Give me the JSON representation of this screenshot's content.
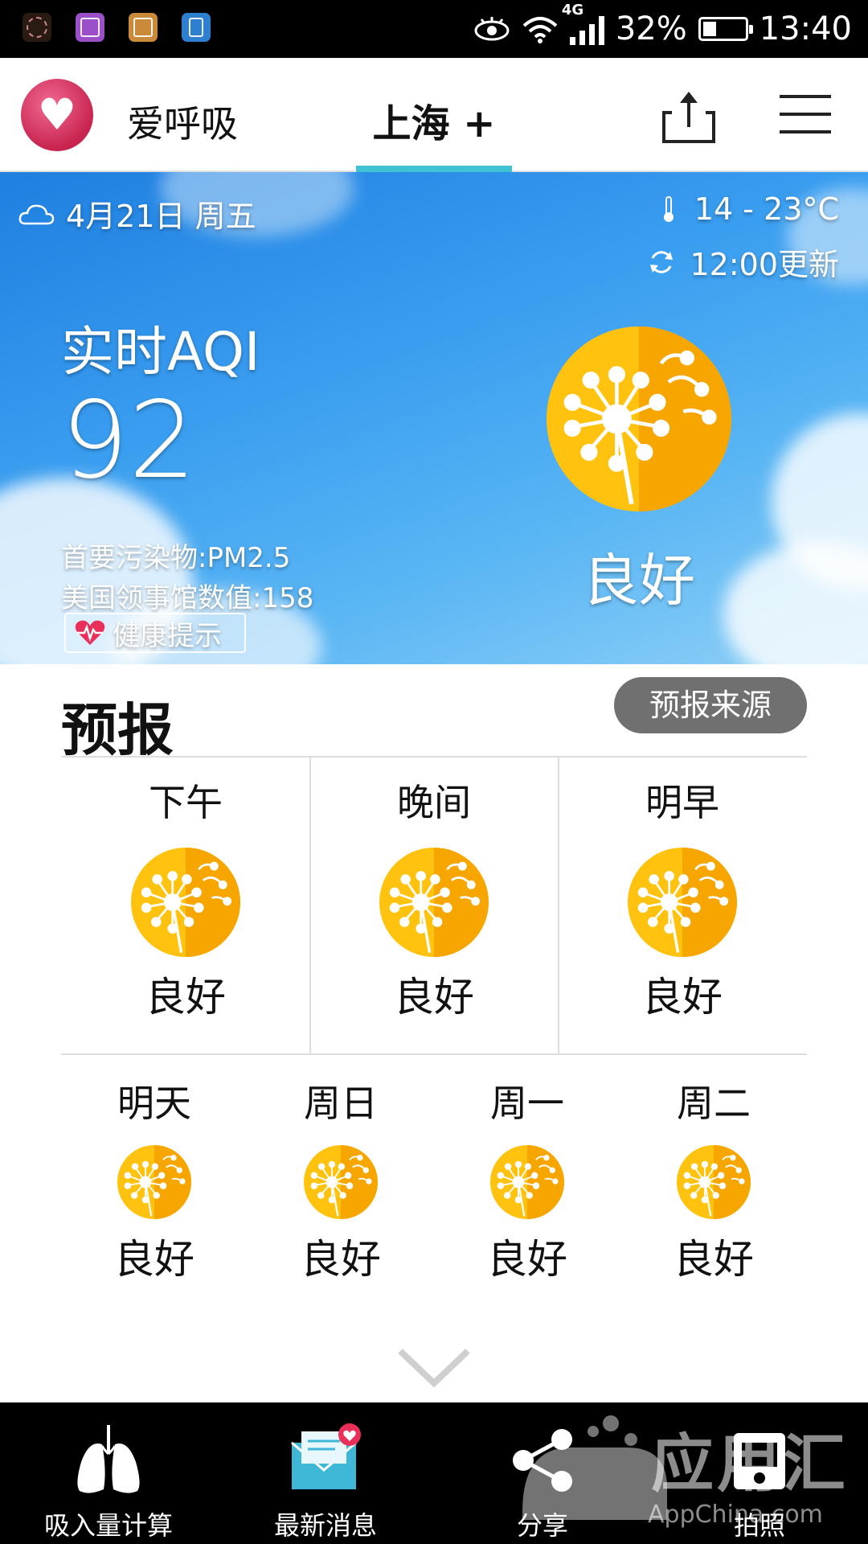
{
  "status_bar": {
    "network": "4G",
    "battery": "32%",
    "time": "13:40",
    "battery_fraction": 0.32
  },
  "header": {
    "app_name": "爱呼吸",
    "city_tab": "上海 +"
  },
  "hero": {
    "date": "4月21日 周五",
    "temperature": "14 - 23°C",
    "update_time": "12:00更新",
    "aqi_label": "实时AQI",
    "aqi_value": "92",
    "primary_pollutant": "首要污染物:PM2.5",
    "us_consulate": "美国领事馆数值:158",
    "health_tip": "健康提示",
    "level": "良好"
  },
  "forecast": {
    "title": "预报",
    "source_button": "预报来源",
    "periods": [
      {
        "label": "下午",
        "level": "良好"
      },
      {
        "label": "晚间",
        "level": "良好"
      },
      {
        "label": "明早",
        "level": "良好"
      }
    ],
    "days": [
      {
        "label": "明天",
        "level": "良好"
      },
      {
        "label": "周日",
        "level": "良好"
      },
      {
        "label": "周一",
        "level": "良好"
      },
      {
        "label": "周二",
        "level": "良好"
      }
    ]
  },
  "bottom_nav": {
    "items": [
      {
        "label": "吸入量计算",
        "icon": "lungs-icon"
      },
      {
        "label": "最新消息",
        "icon": "envelope-icon"
      },
      {
        "label": "分享",
        "icon": "share-icon"
      },
      {
        "label": "拍照",
        "icon": "camera-icon"
      }
    ]
  },
  "watermark": {
    "text": "应用汇",
    "sub": "AppChina.com"
  },
  "colors": {
    "accent_underline": "#3ec2d4",
    "aqi_good": "#f5b400",
    "source_button_bg": "#707070",
    "logo": "#d63a63"
  }
}
